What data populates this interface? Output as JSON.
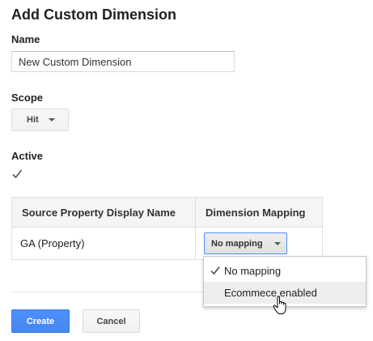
{
  "dialog": {
    "title": "Add Custom Dimension"
  },
  "name_field": {
    "label": "Name",
    "value": "New Custom Dimension"
  },
  "scope": {
    "label": "Scope",
    "selected": "Hit"
  },
  "active": {
    "label": "Active",
    "checked": true
  },
  "mapping_table": {
    "headers": [
      "Source Property Display Name",
      "Dimension Mapping"
    ],
    "rows": [
      {
        "source": "GA (Property)",
        "mapping": "No mapping"
      }
    ]
  },
  "mapping_dropdown": {
    "options": [
      {
        "label": "No mapping",
        "selected": true
      },
      {
        "label": "Ecommece enabled",
        "selected": false,
        "hovered": true
      }
    ]
  },
  "actions": {
    "create_label": "Create",
    "cancel_label": "Cancel"
  },
  "colors": {
    "primary_button": "#4d90fe",
    "focus_border": "#4d90fe",
    "hover_background": "#eeeeee"
  },
  "icons": [
    "caret-down-icon",
    "checkmark-icon",
    "hand-pointer-cursor-icon"
  ]
}
